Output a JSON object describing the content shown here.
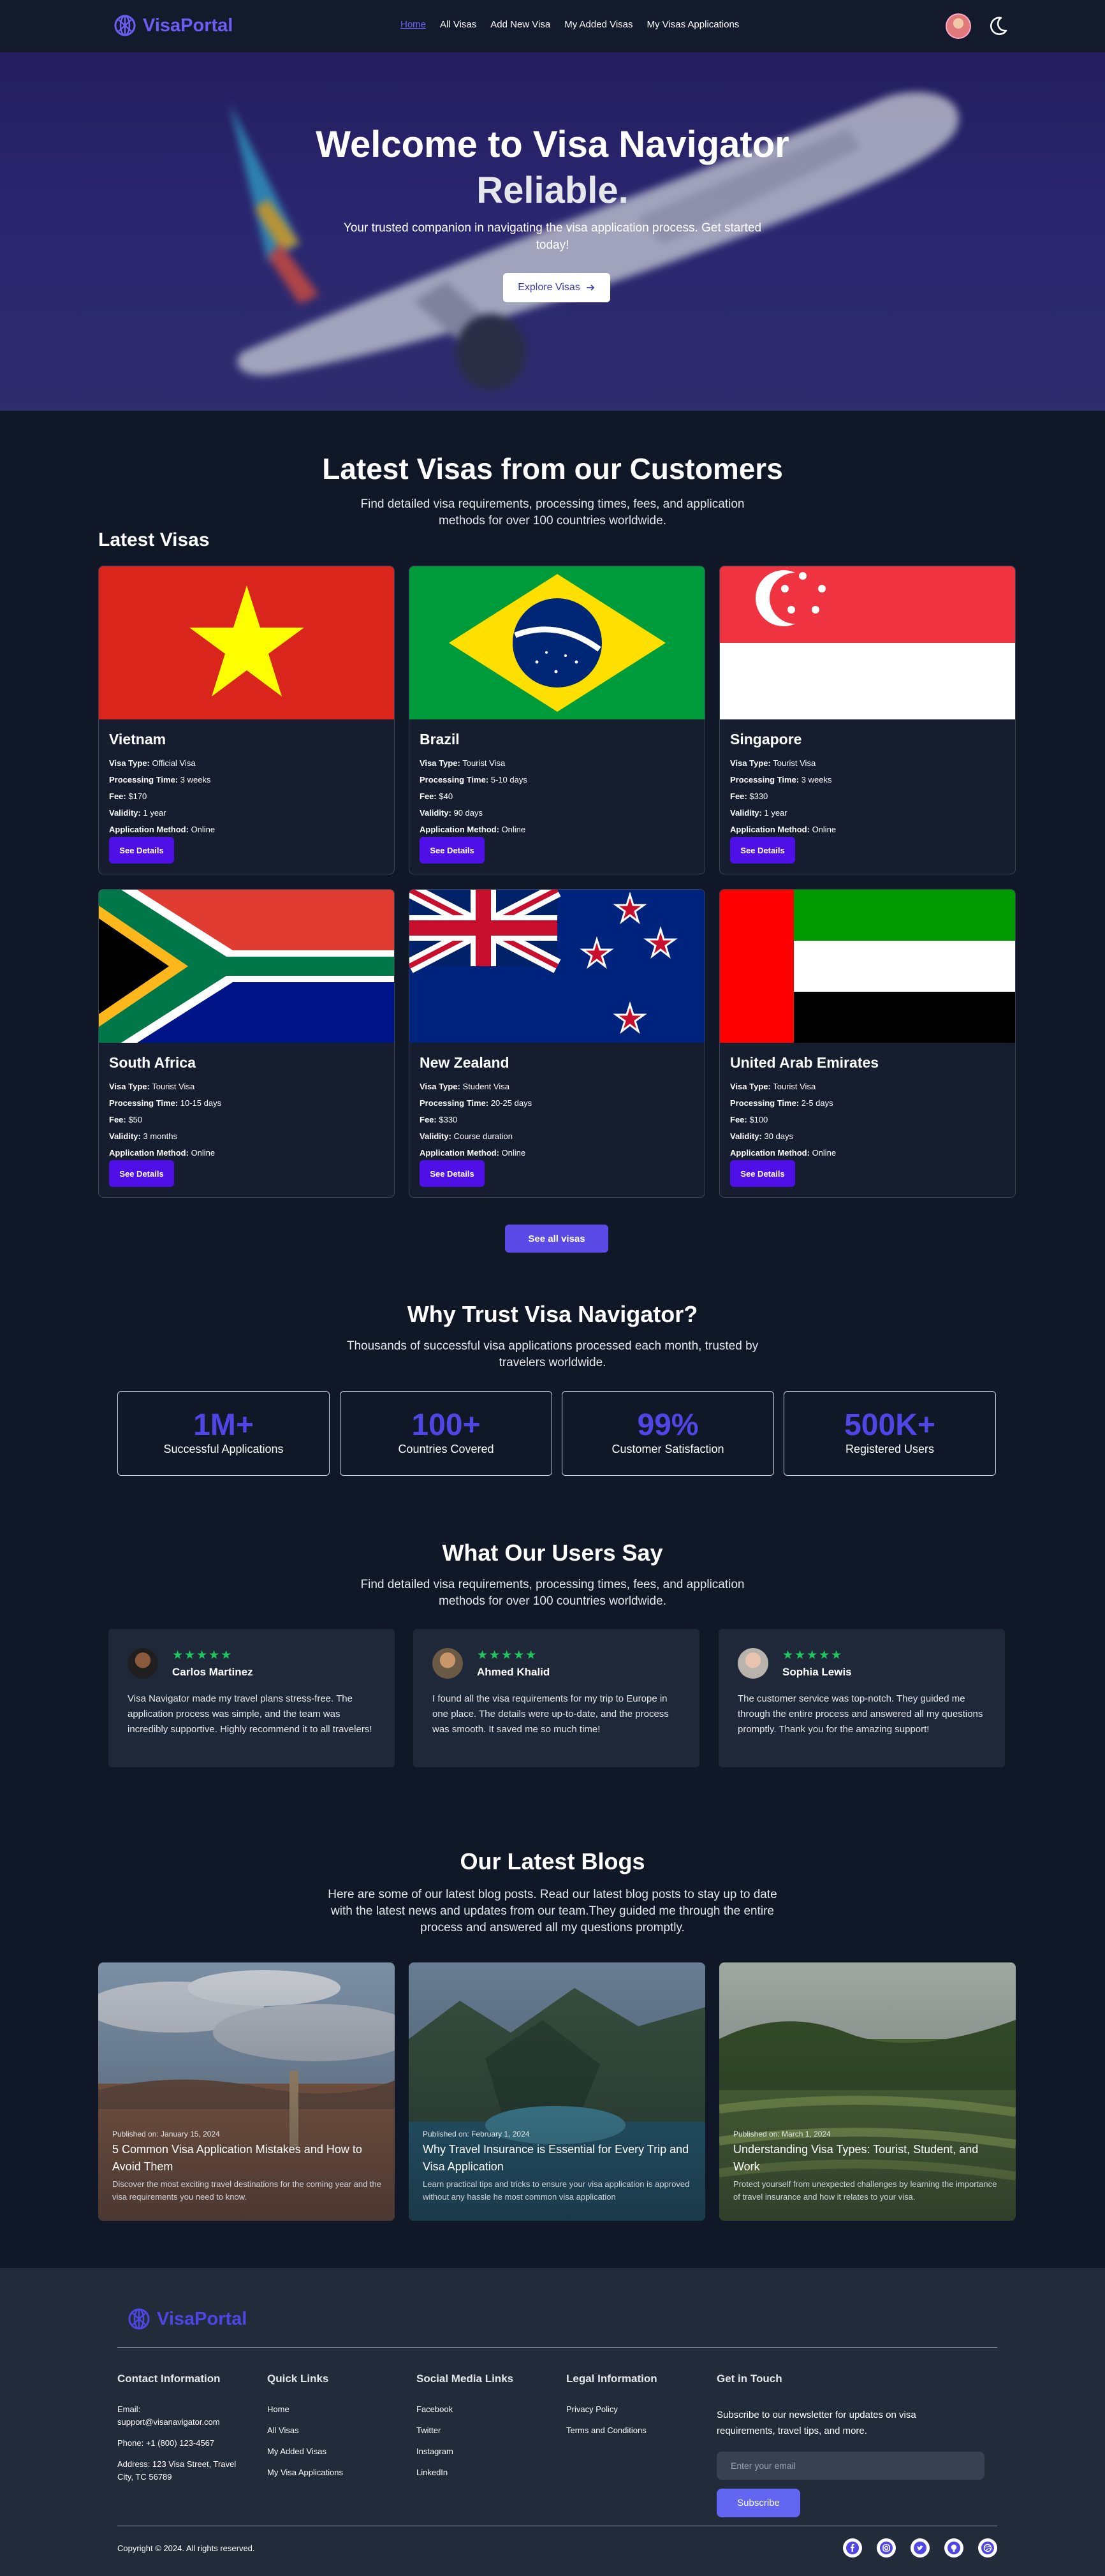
{
  "nav": {
    "brand": "VisaPortal",
    "links": [
      "Home",
      "All Visas",
      "Add New Visa",
      "My Added Visas",
      "My Visas Applications"
    ],
    "active": "Home",
    "icons": [
      "globe-logo-icon",
      "avatar",
      "moon-icon"
    ]
  },
  "hero": {
    "title": "Welcome to Visa Navigator",
    "subtitle": "Reliable.",
    "description": "Your trusted companion in navigating the visa application process. Get started today!",
    "button": "Explore Visas",
    "button_icon": "arrow-right-icon"
  },
  "latest": {
    "title": "Latest Visas from our Customers",
    "description": "Find detailed visa requirements, processing times, fees, and application methods for over 100 countries worldwide.",
    "label": "Latest Visas",
    "field_labels": {
      "type": "Visa Type:",
      "time": "Processing Time:",
      "fee": "Fee:",
      "validity": "Validity:",
      "method": "Application Method:"
    },
    "details_button": "See Details",
    "see_all": "See all visas",
    "cards": [
      {
        "country": "Vietnam",
        "type": "Official Visa",
        "time": "3 weeks",
        "fee": "$170",
        "validity": "1 year",
        "method": "Online"
      },
      {
        "country": "Brazil",
        "type": "Tourist Visa",
        "time": "5-10 days",
        "fee": "$40",
        "validity": "90 days",
        "method": "Online"
      },
      {
        "country": "Singapore",
        "type": "Tourist Visa",
        "time": "3 weeks",
        "fee": "$330",
        "validity": "1 year",
        "method": "Online"
      },
      {
        "country": "South Africa",
        "type": "Tourist Visa",
        "time": "10-15 days",
        "fee": "$50",
        "validity": "3 months",
        "method": "Online"
      },
      {
        "country": "New Zealand",
        "type": "Student Visa",
        "time": "20-25 days",
        "fee": "$330",
        "validity": "Course duration",
        "method": "Online"
      },
      {
        "country": "United Arab Emirates",
        "type": "Tourist Visa",
        "time": "2-5 days",
        "fee": "$100",
        "validity": "30 days",
        "method": "Online"
      }
    ]
  },
  "trust": {
    "title": "Why Trust Visa Navigator?",
    "description": "Thousands of successful visa applications processed each month, trusted by travelers worldwide.",
    "stats": [
      {
        "value": "1M+",
        "label": "Successful Applications"
      },
      {
        "value": "100+",
        "label": "Countries Covered"
      },
      {
        "value": "99%",
        "label": "Customer Satisfaction"
      },
      {
        "value": "500K+",
        "label": "Registered Users"
      }
    ]
  },
  "testimonials": {
    "title": "What Our Users Say",
    "description": "Find detailed visa requirements, processing times, fees, and application methods for over 100 countries worldwide.",
    "rating": 5,
    "items": [
      {
        "name": "Carlos Martinez",
        "stars": "★★★★★",
        "quote": "Visa Navigator made my travel plans stress-free. The application process was simple, and the team was incredibly supportive. Highly recommend it to all travelers!"
      },
      {
        "name": "Ahmed Khalid",
        "stars": "★★★★★",
        "quote": "I found all the visa requirements for my trip to Europe in one place. The details were up-to-date, and the process was smooth. It saved me so much time!"
      },
      {
        "name": "Sophia Lewis",
        "stars": "★★★★★",
        "quote": "The customer service was top-notch. They guided me through the entire process and answered all my questions promptly. Thank you for the amazing support!"
      }
    ]
  },
  "blogs": {
    "title": "Our Latest Blogs",
    "description": "Here are some of our latest blog posts. Read our latest blog posts to stay up to date with the latest news and updates from our team.They guided me through the entire process and answered all my questions promptly.",
    "items": [
      {
        "date": "Published on: January 15, 2024",
        "title": "5 Common Visa Application Mistakes and How to Avoid Them",
        "desc": "Discover the most exciting travel destinations for the coming year and the visa requirements you need to know."
      },
      {
        "date": "Published on: February 1, 2024",
        "title": "Why Travel Insurance is Essential for Every Trip and Visa Application",
        "desc": "Learn practical tips and tricks to ensure your visa application is approved without any hassle he most common visa application"
      },
      {
        "date": "Published on: March 1, 2024",
        "title": "Understanding Visa Types: Tourist, Student, and Work",
        "desc": "Protect yourself from unexpected challenges by learning the importance of travel insurance and how it relates to your visa."
      }
    ]
  },
  "footer": {
    "brand": "VisaPortal",
    "contact": {
      "heading": "Contact Information",
      "email_label": "Email:",
      "email": "support@visanavigator.com",
      "phone": "Phone: +1 (800) 123-4567",
      "address": "Address: 123 Visa Street, Travel City, TC 56789"
    },
    "quick_links": {
      "heading": "Quick Links",
      "items": [
        "Home",
        "All Visas",
        "My Added Visas",
        "My Visa Applications"
      ]
    },
    "social_links": {
      "heading": "Social Media Links",
      "items": [
        "Facebook",
        "Twitter",
        "Instagram",
        "LinkedIn"
      ]
    },
    "legal": {
      "heading": "Legal Information",
      "items": [
        "Privacy Policy",
        "Terms and Conditions"
      ]
    },
    "newsletter": {
      "heading": "Get in Touch",
      "text": "Subscribe to our newsletter for updates on visa requirements, travel tips, and more.",
      "placeholder": "Enter your email",
      "button": "Subscribe"
    },
    "copyright": "Copyright © 2024. All rights reserved.",
    "social_icons": [
      "facebook-icon",
      "instagram-icon",
      "twitter-icon",
      "github-icon",
      "dribbble-icon"
    ]
  },
  "colors": {
    "background": "#101828",
    "accent": "#4f46e5",
    "button": "#4f10e8",
    "stars": "#22c55e"
  }
}
